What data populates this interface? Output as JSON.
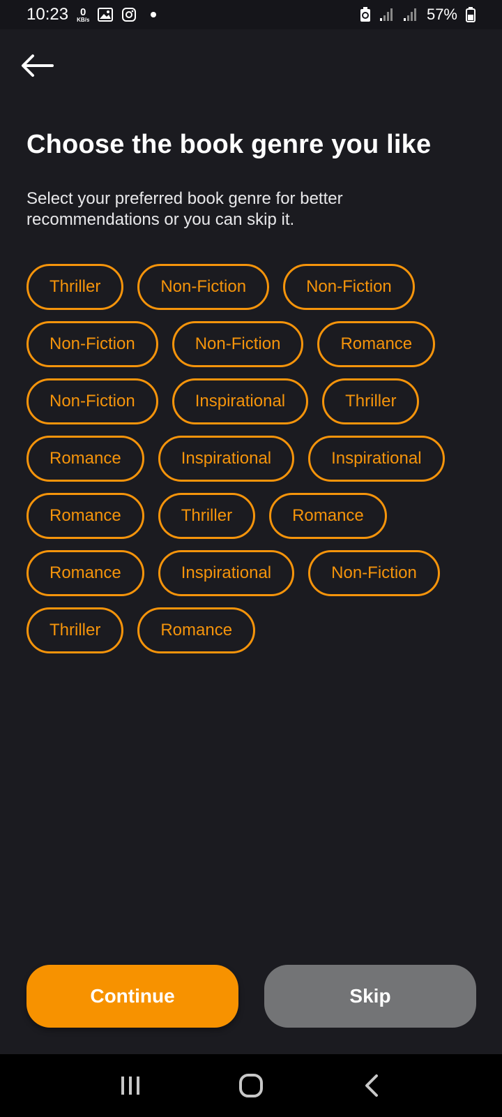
{
  "status_bar": {
    "time": "10:23",
    "net_speed_value": "0",
    "net_speed_unit": "KB/s",
    "battery": "57%",
    "icons": [
      "image-icon",
      "instagram-icon",
      "notification-dot",
      "battery-saver-icon",
      "signal-icon",
      "signal-icon",
      "battery-icon"
    ]
  },
  "header": {
    "back_icon": "arrow-left-icon",
    "title": "Choose the book genre you like",
    "subtitle": "Select your preferred book genre for better recommendations or you can skip it."
  },
  "genres": [
    "Thriller",
    "Non-Fiction",
    "Non-Fiction",
    "Non-Fiction",
    "Non-Fiction",
    "Romance",
    "Non-Fiction",
    "Inspirational",
    "Thriller",
    "Romance",
    "Inspirational",
    "Inspirational",
    "Romance",
    "Thriller",
    "Romance",
    "Romance",
    "Inspirational",
    "Non-Fiction",
    "Thriller",
    "Romance"
  ],
  "actions": {
    "continue_label": "Continue",
    "skip_label": "Skip"
  },
  "colors": {
    "accent": "#f5940b",
    "background": "#1b1b20",
    "skip_button": "#737476"
  },
  "nav_bar": {
    "icons": [
      "recent-apps-icon",
      "home-icon",
      "back-nav-icon"
    ]
  }
}
